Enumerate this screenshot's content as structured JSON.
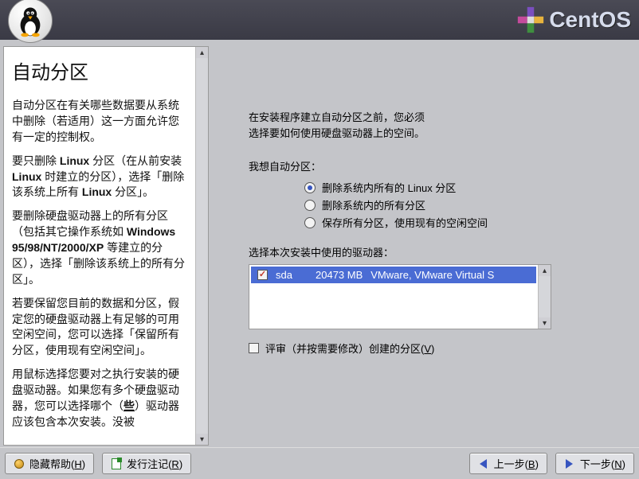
{
  "brand": "CentOS",
  "help": {
    "title": "自动分区",
    "p1_a": "自动分区在有关哪些数据要从系统中删除（若适用）这一方面允许您有一定的控制权。",
    "p2_a": "要只删除 ",
    "p2_b": "Linux",
    "p2_c": " 分区（在从前安装 ",
    "p2_d": "Linux",
    "p2_e": " 时建立的分区），选择「删除该系统上所有 ",
    "p2_f": "Linux",
    "p2_g": " 分区」。",
    "p3_a": "要删除硬盘驱动器上的所有分区（包括其它操作系统如 ",
    "p3_b": "Windows 95/98/NT/2000/XP",
    "p3_c": " 等建立的分区），选择「删除该系统上的所有分区」。",
    "p4": "若要保留您目前的数据和分区，假定您的硬盘驱动器上有足够的可用空闲空间，您可以选择「保留所有分区，使用现有空闲空间」。",
    "p5_a": "用鼠标选择您要对之执行安装的硬盘驱动器。如果您有多个硬盘驱动器，您可以选择哪个（",
    "p5_b": "些",
    "p5_c": "）驱动器应该包含本次安装。没被"
  },
  "main": {
    "intro": "在安装程序建立自动分区之前，您必须\n选择要如何使用硬盘驱动器上的空间。",
    "iwant": "我想自动分区：",
    "opt1": "删除系统内所有的 Linux 分区",
    "opt2": "删除系统内的所有分区",
    "opt3": "保存所有分区，使用现有的空闲空间",
    "selected": 0,
    "drives_label": "选择本次安装中使用的驱动器：",
    "drive": {
      "name": "sda",
      "size": "20473 MB",
      "desc": "VMware, VMware Virtual S",
      "checked": true
    },
    "review_label_a": "评审（并按需要修改）创建的分区(",
    "review_mnemonic": "V",
    "review_label_b": ")",
    "review_checked": false
  },
  "footer": {
    "hide_help_a": "隐藏帮助(",
    "hide_help_m": "H",
    "hide_help_b": ")",
    "release_notes_a": "发行注记(",
    "release_notes_m": "R",
    "release_notes_b": ")",
    "back_a": "上一步(",
    "back_m": "B",
    "back_b": ")",
    "next_a": "下一步(",
    "next_m": "N",
    "next_b": ")"
  }
}
